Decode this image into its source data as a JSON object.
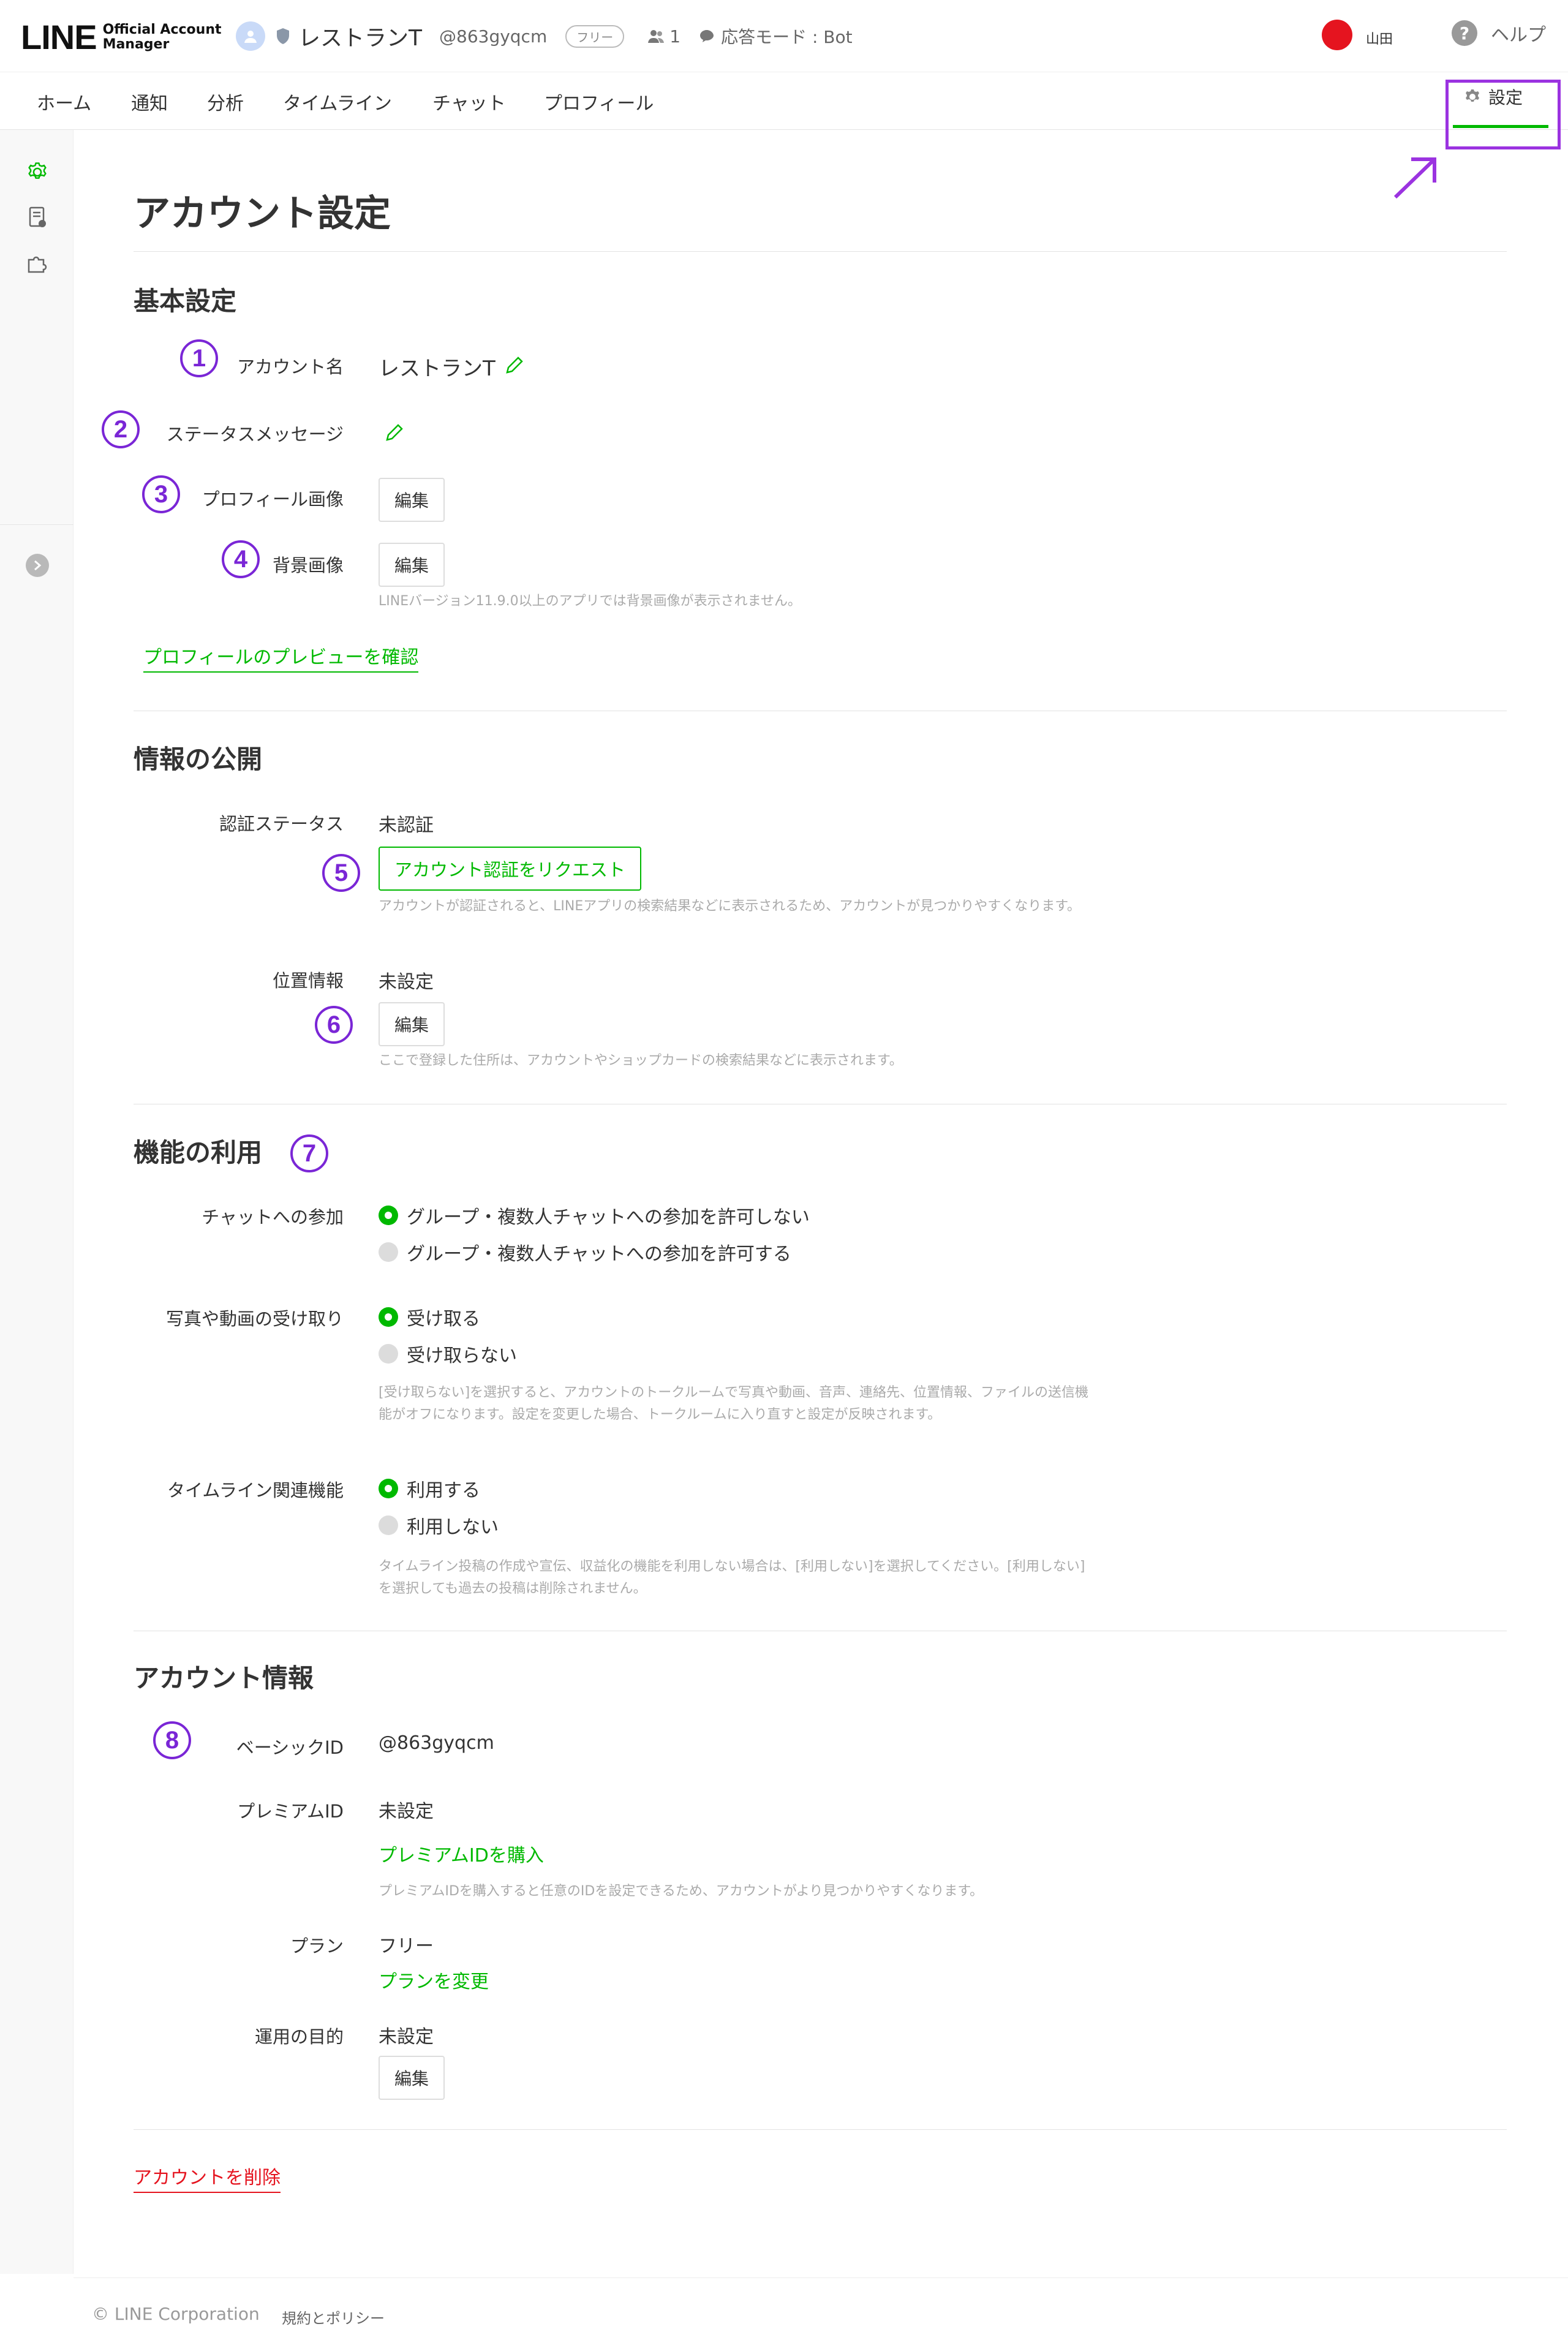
{
  "header": {
    "logo_main": "LINE",
    "logo_sub_line1": "Official Account",
    "logo_sub_line2": "Manager",
    "account_name": "レストランT",
    "account_id": "@863gyqcm",
    "plan_badge": "フリー",
    "friend_count": "1",
    "response_mode": "応答モード : Bot",
    "user_name": "山田",
    "help_label": "ヘルプ",
    "help_icon": "?"
  },
  "nav": {
    "tabs": [
      {
        "label": "ホーム"
      },
      {
        "label": "通知"
      },
      {
        "label": "分析"
      },
      {
        "label": "タイムライン"
      },
      {
        "label": "チャット"
      },
      {
        "label": "プロフィール"
      }
    ],
    "settings_label": "設定"
  },
  "page": {
    "title": "アカウント設定"
  },
  "basic": {
    "title": "基本設定",
    "account_name_label": "アカウント名",
    "account_name_value": "レストランT",
    "status_message_label": "ステータスメッセージ",
    "profile_image_label": "プロフィール画像",
    "profile_image_button": "編集",
    "background_image_label": "背景画像",
    "background_image_button": "編集",
    "background_note": "LINEバージョン11.9.0以上のアプリでは背景画像が表示されません。",
    "preview_link": "プロフィールのプレビューを確認"
  },
  "publication": {
    "title": "情報の公開",
    "auth_status_label": "認証ステータス",
    "auth_status_value": "未認証",
    "auth_request_button": "アカウント認証をリクエスト",
    "auth_note": "アカウントが認証されると、LINEアプリの検索結果などに表示されるため、アカウントが見つかりやすくなります。",
    "location_label": "位置情報",
    "location_value": "未設定",
    "location_button": "編集",
    "location_note": "ここで登録した住所は、アカウントやショップカードの検索結果などに表示されます。"
  },
  "features": {
    "title": "機能の利用",
    "chat_label": "チャットへの参加",
    "chat_options": [
      "グループ・複数人チャットへの参加を許可しない",
      "グループ・複数人チャットへの参加を許可する"
    ],
    "chat_selected": 0,
    "media_label": "写真や動画の受け取り",
    "media_options": [
      "受け取る",
      "受け取らない"
    ],
    "media_selected": 0,
    "media_note": "[受け取らない]を選択すると、アカウントのトークルームで写真や動画、音声、連絡先、位置情報、ファイルの送信機能がオフになります。設定を変更した場合、トークルームに入り直すと設定が反映されます。",
    "timeline_label": "タイムライン関連機能",
    "timeline_options": [
      "利用する",
      "利用しない"
    ],
    "timeline_selected": 0,
    "timeline_note": "タイムライン投稿の作成や宣伝、収益化の機能を利用しない場合は、[利用しない]を選択してください。[利用しない]を選択しても過去の投稿は削除されません。"
  },
  "account_info": {
    "title": "アカウント情報",
    "basic_id_label": "ベーシックID",
    "basic_id_value": "@863gyqcm",
    "premium_id_label": "プレミアムID",
    "premium_id_value": "未設定",
    "premium_id_link": "プレミアムIDを購入",
    "premium_id_note": "プレミアムIDを購入すると任意のIDを設定できるため、アカウントがより見つかりやすくなります。",
    "plan_label": "プラン",
    "plan_value": "フリー",
    "plan_link": "プランを変更",
    "purpose_label": "運用の目的",
    "purpose_value": "未設定",
    "purpose_button": "編集"
  },
  "delete_link": "アカウントを削除",
  "footer": {
    "copyright": "© LINE Corporation",
    "terms": "規約とポリシー"
  },
  "annotations": [
    "1",
    "2",
    "3",
    "4",
    "5",
    "6",
    "7",
    "8"
  ],
  "colors": {
    "accent": "#00b900",
    "annotation": "#7a26d6",
    "danger": "#e5141f"
  },
  "icons": {
    "sidebar": [
      "gear-icon",
      "document-icon",
      "puzzle-icon"
    ]
  }
}
